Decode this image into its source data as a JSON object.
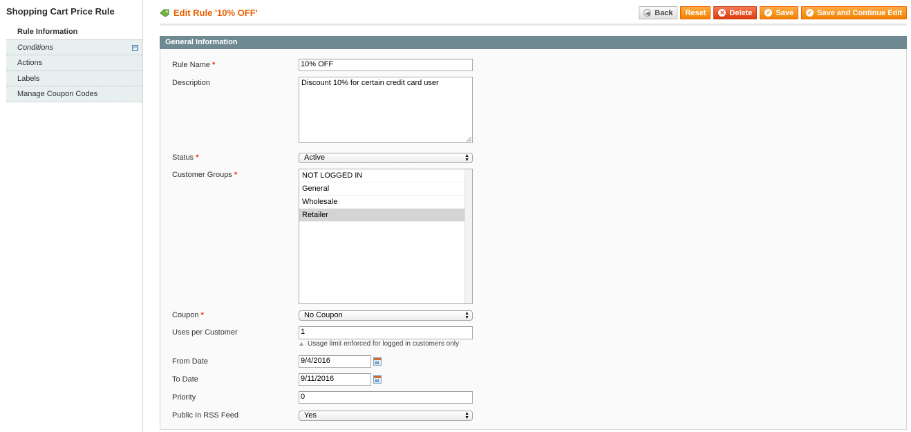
{
  "sidebar": {
    "title": "Shopping Cart Price Rule",
    "tabs": [
      {
        "label": "Rule Information"
      },
      {
        "label": "Conditions"
      },
      {
        "label": "Actions"
      },
      {
        "label": "Labels"
      },
      {
        "label": "Manage Coupon Codes"
      }
    ]
  },
  "header": {
    "title": "Edit Rule '10% OFF'",
    "buttons": {
      "back": "Back",
      "reset": "Reset",
      "delete": "Delete",
      "save": "Save",
      "save_continue": "Save and Continue Edit"
    }
  },
  "section": {
    "title": "General Information"
  },
  "form": {
    "rule_name": {
      "label": "Rule Name",
      "required": "*",
      "value": "10% OFF"
    },
    "description": {
      "label": "Description",
      "value": "Discount 10% for certain credit card user"
    },
    "status": {
      "label": "Status",
      "required": "*",
      "value": "Active"
    },
    "customer_groups": {
      "label": "Customer Groups",
      "required": "*",
      "options": [
        "NOT LOGGED IN",
        "General",
        "Wholesale",
        "Retailer"
      ],
      "selected": "Retailer"
    },
    "coupon": {
      "label": "Coupon",
      "required": "*",
      "value": "No Coupon"
    },
    "uses_per_customer": {
      "label": "Uses per Customer",
      "value": "1",
      "note": "Usage limit enforced for logged in customers only"
    },
    "from_date": {
      "label": "From Date",
      "value": "9/4/2016"
    },
    "to_date": {
      "label": "To Date",
      "value": "9/11/2016"
    },
    "priority": {
      "label": "Priority",
      "value": "0"
    },
    "public_rss": {
      "label": "Public In RSS Feed",
      "value": "Yes"
    }
  },
  "colors": {
    "accent_orange": "#eb5e00",
    "section_header": "#6f8992",
    "required_star": "#eb340a",
    "selected_option": "#d4d4d4"
  }
}
